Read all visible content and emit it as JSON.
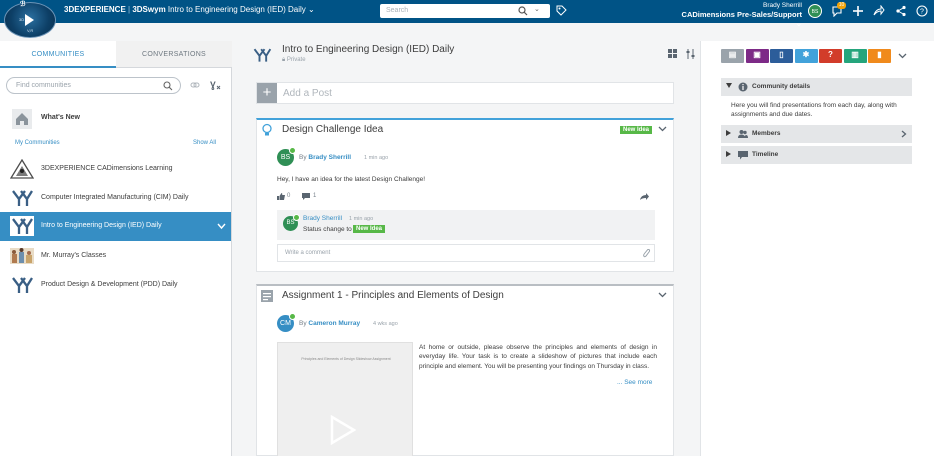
{
  "topbar": {
    "brand": "3DEXPERIENCE",
    "separator": " | ",
    "app": "3DSwym",
    "community": "Intro to Engineering Design (IED) Daily",
    "search_placeholder": "Search",
    "user_name": "Brady Sherrill",
    "user_company": "CADimensions Pre-Sales/Support",
    "avatar_initials": "BS",
    "notification_count": "10",
    "compass_top": "3D",
    "compass_left": "3D",
    "compass_bottom": "V,R"
  },
  "left_panel": {
    "tabs": [
      "COMMUNITIES",
      "CONVERSATIONS"
    ],
    "find_placeholder": "Find communities",
    "whats_new": "What's New",
    "my_communities_label": "My Communities",
    "show_all": "Show All",
    "communities": [
      {
        "name": "3DEXPERIENCE CADimensions Learning",
        "icon": "3dexperience-logo-icon"
      },
      {
        "name": "Computer Integrated Manufacturing (CIM) Daily",
        "icon": "pltw-logo-icon"
      },
      {
        "name": "Intro to Engineering Design (IED) Daily",
        "icon": "pltw-logo-icon",
        "selected": true
      },
      {
        "name": "Mr. Murray's Classes",
        "icon": "classroom-photo-icon"
      },
      {
        "name": "Product Design & Development (PDD) Daily",
        "icon": "pltw-logo-icon"
      }
    ]
  },
  "community_header": {
    "title": "Intro to Engineering Design (IED) Daily",
    "visibility": "Private"
  },
  "add_post": "Add a Post",
  "posts": [
    {
      "title": "Design Challenge Idea",
      "status_badge": "New Idea",
      "author_initials": "BS",
      "by": "By",
      "author": "Brady Sherrill",
      "time": "1 min ago",
      "body": "Hey, I have an idea for the latest Design Challenge!",
      "likes": "0",
      "comments": "1",
      "reply": {
        "initials": "BS",
        "author": "Brady Sherrill",
        "time": "1 min ago",
        "status_text": "Status change to",
        "status_badge": "New Idea"
      },
      "comment_placeholder": "Write a comment"
    },
    {
      "title": "Assignment 1 - Principles and Elements of Design",
      "author_initials": "CM",
      "by": "By",
      "author": "Cameron Murray",
      "time": "4 wks ago",
      "thumbnail_caption": "Principles and Elements of Design Slideshow Assignment",
      "body": "At home or outside, please observe the principles and elements of design in everyday life. Your task is to create a slideshow of pictures that include each principle and element. You will be presenting your findings on Thursday in class.",
      "see_more": "... See more"
    }
  ],
  "right_panel": {
    "toolbar": [
      {
        "icon": "media-icon",
        "color": "#9aa3ab"
      },
      {
        "icon": "image-icon",
        "color": "#7d2a87"
      },
      {
        "icon": "document-icon",
        "color": "#2c5d9a"
      },
      {
        "icon": "idea-icon",
        "color": "#42a2da"
      },
      {
        "icon": "question-icon",
        "color": "#d23c2a"
      },
      {
        "icon": "wiki-icon",
        "color": "#25a57c"
      },
      {
        "icon": "survey-icon",
        "color": "#f08a1c"
      }
    ],
    "sections": {
      "details_title": "Community details",
      "details_desc": "Here you will find presentations from each day, along with assignments and due dates.",
      "members": "Members",
      "timeline": "Timeline"
    }
  },
  "colors": {
    "topbar": "#005386",
    "accent": "#368ec4",
    "new_idea": "#57b847"
  }
}
